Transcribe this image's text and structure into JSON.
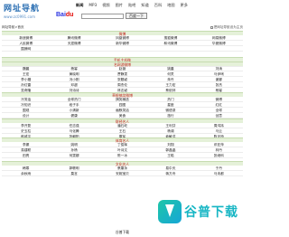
{
  "header": {
    "logo_main": "网址导航",
    "logo_sub": "www.zc0991.com",
    "nav": [
      "新闻",
      "MP3",
      "视频",
      "图片",
      "贴吧",
      "知道",
      "百科",
      "地图",
      "更多"
    ],
    "nav_active_index": 0,
    "search_button": "百度一下",
    "search_value": ""
  },
  "top_strip": {
    "left": "网址导航>首页",
    "right": "把网址导航设为主页"
  },
  "sections": [
    {
      "title": "微博",
      "rows": [
        [
          "新浪微博",
          "腾讯微博",
          "凤凰微博",
          "搜狐微博",
          "网易微博"
        ],
        [
          "人民微博",
          "天涯微博",
          "新华微博",
          "和讯微博",
          "华夏微博"
        ],
        [
          "围脖网",
          "",
          "",
          "",
          ""
        ]
      ]
    },
    {
      "title": "手机主机微",
      "rows": [
        [
          "新浪微博手机版",
          "搜狐微博手机版",
          "腾讯微博手机版",
          "",
          ""
        ]
      ]
    },
    {
      "title": "名网游微博",
      "rows": [
        [
          "魏晨",
          "杨幂",
          "赵薇",
          "姚晨",
          "刘涛"
        ],
        [
          "王宏",
          "黄晓明",
          "贾静雯",
          "何炅",
          "马伊琍"
        ],
        [
          "李小璐",
          "冯小刚",
          "张靓颖",
          "朱丹",
          "谢娜"
        ],
        [
          "孙红雷",
          "邓超",
          "周杰伦",
          "王力宏",
          "张杰"
        ],
        [
          "吴奇隆",
          "刘诗诗",
          "林志颖",
          "蔡依林",
          "杨幂"
        ]
      ]
    },
    {
      "title": "草根搞笑微博",
      "rows": [
        [
          "冷笑话",
          "全球热门",
          "搞笑精选",
          "热门",
          "微博"
        ],
        [
          "冷知识",
          "段子手",
          "囧图",
          "星座",
          "红红"
        ],
        [
          "围观",
          "小清新",
          "幽默笑话",
          "微语录",
          "全球"
        ],
        [
          "设计",
          "健康",
          "美食",
          "旅行",
          "创意"
        ]
      ]
    },
    {
      "title": "财经名人",
      "rows": [
        [
          "李开复",
          "任志强",
          "潘石屹",
          "王利芬",
          "周鸿祎"
        ],
        [
          "史玉柱",
          "马化腾",
          "王石",
          "杨澜",
          "马云"
        ],
        [
          "郎咸平",
          "张朝阳",
          "雷军",
          "俞敏洪",
          "陈天桥"
        ]
      ]
    },
    {
      "title": "体育名人",
      "rows": [
        [
          "李娜",
          "姚明",
          "丁俊晖",
          "刘翔",
          "邓亚萍"
        ],
        [
          "易建联",
          "孙杨",
          "叶诗文",
          "郭晶晶",
          "林丹"
        ],
        [
          "田亮",
          "何雯娜",
          "陈一冰",
          "王皓",
          "张继科"
        ]
      ]
    },
    {
      "title": "文化名人",
      "rows": [
        [
          "韩寒",
          "郭敬明",
          "蔡康永",
          "易中天",
          "于丹"
        ],
        [
          "余秋雨",
          "莫言",
          "安妮宝贝",
          "蒋方舟",
          "马未都"
        ]
      ]
    }
  ],
  "watermark": "谷普下载",
  "bottom_text": "谷普下载"
}
